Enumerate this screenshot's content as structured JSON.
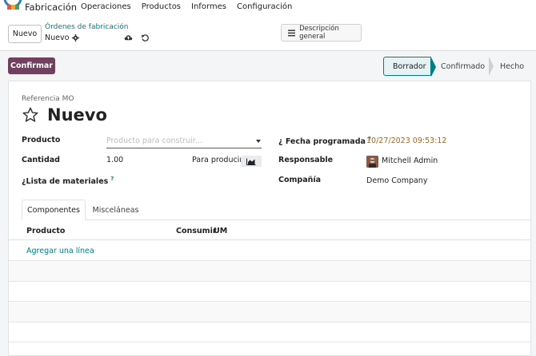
{
  "nav": {
    "app_name": "Fabricación",
    "menu": [
      "Operaciones",
      "Productos",
      "Informes",
      "Configuración"
    ]
  },
  "control": {
    "new_label": "Nuevo",
    "breadcrumb": "Órdenes de fabricación",
    "record": "Nuevo",
    "overview_label": "Descripción general"
  },
  "actions": {
    "confirm_label": "Confirmar",
    "stages": [
      "Borrador",
      "Confirmado",
      "Hecho"
    ],
    "active_stage": "Borrador"
  },
  "form": {
    "ref_label": "Referencia MO",
    "title": "Nuevo",
    "product_label": "Producto",
    "product_placeholder": "Producto para construir...",
    "quantity_label": "Cantidad",
    "quantity_value": "1.00",
    "to_produce_label": "Para producir",
    "bom_label": "¿Lista de materiales",
    "bom_help": "?",
    "date_label": "¿ Fecha programada",
    "date_help": "?",
    "date_value": "10/27/2023 09:53:12",
    "responsible_label": "Responsable",
    "responsible_value": "Mitchell Admin",
    "company_label": "Compañía",
    "company_value": "Demo Company"
  },
  "tabs": [
    "Componentes",
    "Misceláneas"
  ],
  "table": {
    "headers": [
      "Producto",
      "Consumir",
      "UM"
    ],
    "add_line": "Agregar una línea"
  },
  "colors": {
    "primary": "#71405f",
    "accent": "#017e84",
    "date": "#a0682a"
  }
}
